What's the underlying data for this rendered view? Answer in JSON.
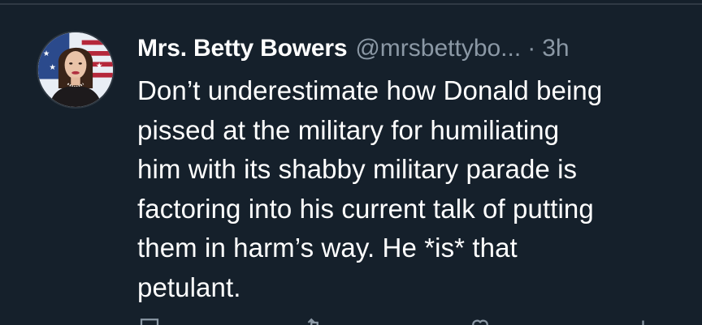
{
  "tweet": {
    "author": {
      "display_name": "Mrs. Betty Bowers",
      "handle": "@mrsbettybo...",
      "avatar_icon": "profile-photo"
    },
    "separator": "·",
    "time": "3h",
    "text_lines": [
      "Don’t underestimate how Donald being",
      "pissed at the military for humiliating",
      "him with its shabby military parade is",
      "factoring into his current talk of putting",
      "them in harm’s way. He *is* that",
      "petulant."
    ],
    "actions": {
      "reply_icon": "reply-icon",
      "retweet_icon": "retweet-icon",
      "like_icon": "heart-icon",
      "views_icon": "views-icon"
    }
  },
  "colors": {
    "background": "#15202b",
    "text": "#ffffff",
    "secondary": "#8b98a5"
  }
}
